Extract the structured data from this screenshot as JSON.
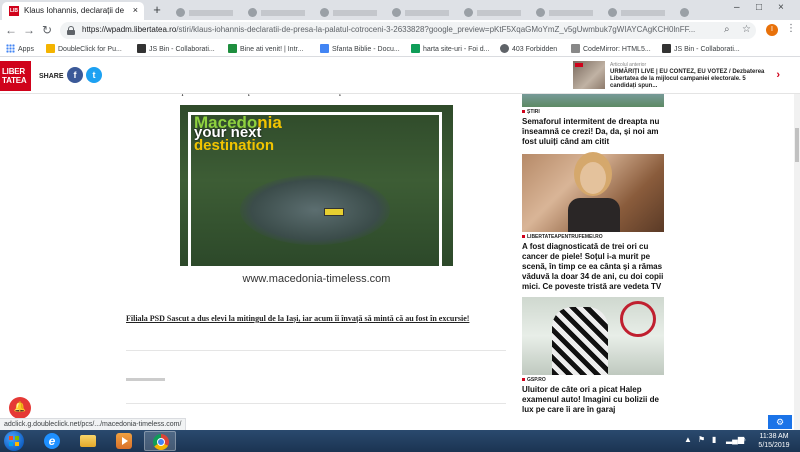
{
  "browser": {
    "active_tab_title": "Klaus Iohannis, declarații de pres",
    "tab_close": "×",
    "new_tab": "+",
    "window_controls": [
      "–",
      "□",
      "×"
    ],
    "url_host": "https://wpadm.libertatea.ro",
    "url_path": "/stiri/klaus-iohannis-declaratii-de-presa-la-palatul-cotroceni-3-2633828?google_preview=pKtF5XqaGMoYmZ_v5gUwmbuk7gWIAYCAgKCH0lnFF...",
    "profile_initial": "I"
  },
  "bookmarks": [
    {
      "label": "Apps",
      "color": "#4285f4"
    },
    {
      "label": "DoubleClick for Pu...",
      "color": "#f4b400"
    },
    {
      "label": "JS Bin - Collaborati...",
      "color": "#333333"
    },
    {
      "label": "Bine ati venit! | Intr...",
      "color": "#1e8e3e"
    },
    {
      "label": "Sfanta Biblie - Docu...",
      "color": "#4285f4"
    },
    {
      "label": "harta site-uri - Foi d...",
      "color": "#0f9d58"
    },
    {
      "label": "403 Forbidden",
      "color": "#5f6368"
    },
    {
      "label": "CodeMirror: HTML5...",
      "color": "#888888"
    },
    {
      "label": "JS Bin - Collaborati...",
      "color": "#333333"
    }
  ],
  "header": {
    "logo_line1": "LIBER",
    "logo_line2": "TATEA",
    "share_label": "SHARE",
    "facebook_glyph": "f",
    "twitter_glyph": "t",
    "ticker_meta": "Articolul anterior",
    "ticker_headline": "URMĂRIȚI LIVE | EU CONTEZ, EU VOTEZ / Dezbaterea Libertatea de la mijlocul campaniei electorale. 5 candidați spun...",
    "ticker_arrow": "›"
  },
  "article": {
    "intro": "Libertatea va va prezenta cele mai importante declaratii facute de presedintele Romaniei.",
    "ad_title_a": "Macedo",
    "ad_title_b": "nia",
    "ad_line2": "your next",
    "ad_line3": "destination",
    "ad_url": "www.macedonia-timeless.com",
    "related_link": "Filiala PSD Sascut a dus elevi la mitingul de la Iași, iar acum îi învață să mintă că au fost în excursie!"
  },
  "sidebar": {
    "items": [
      {
        "category": "ȘTIRI",
        "title": "Semaforul intermitent de dreapta nu înseamnă ce crezi! Da, da, și noi am fost uluiți când am citit"
      },
      {
        "category": "LIBERTATEAPENTRUFEMEI.RO",
        "title": "A fost diagnosticată de trei ori cu cancer de piele! Soțul i-a murit pe scenă, în timp ce ea cânta și a rămas văduvă la doar 34 de ani, cu doi copii mici. Ce poveste tristă are vedeta TV"
      },
      {
        "category": "GSP.RO",
        "title": "Uluitor de câte ori a picat Halep examenul auto! Imagini cu bolizii de lux pe care îi are în garaj"
      }
    ]
  },
  "status_bar": "adclick.g.doubleclick.net/pcs/.../macedonia-timeless.com/",
  "notification_glyph": "🔔",
  "taskbar": {
    "time": "11:38 AM",
    "date": "5/15/2019",
    "tray_arrow": "▲"
  }
}
